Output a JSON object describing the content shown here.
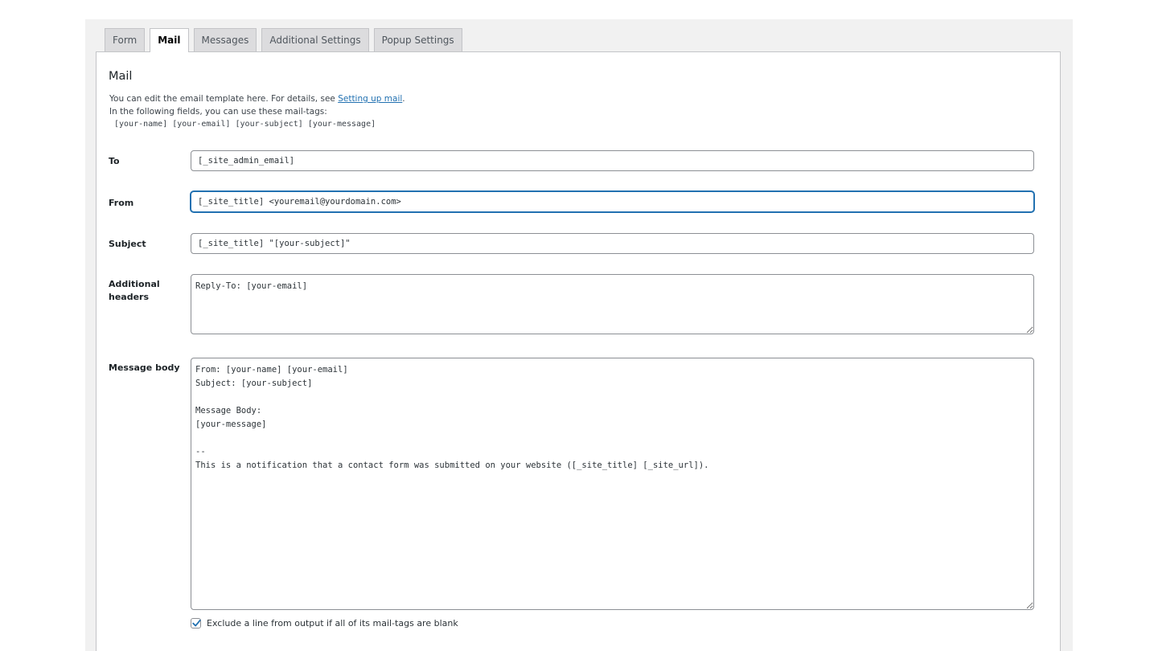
{
  "tabs": [
    {
      "label": "Form",
      "active": false
    },
    {
      "label": "Mail",
      "active": true
    },
    {
      "label": "Messages",
      "active": false
    },
    {
      "label": "Additional Settings",
      "active": false
    },
    {
      "label": "Popup Settings",
      "active": false
    }
  ],
  "mail": {
    "title": "Mail",
    "description_prefix": "You can edit the email template here. For details, see ",
    "description_link": "Setting up mail",
    "description_suffix": ".",
    "description_line2": "In the following fields, you can use these mail-tags:",
    "mail_tags": "[your-name] [your-email] [your-subject] [your-message]"
  },
  "fields": {
    "to": {
      "label": "To",
      "value": "[_site_admin_email]"
    },
    "from": {
      "label": "From",
      "value": "[_site_title] <youremail@yourdomain.com>"
    },
    "subject": {
      "label": "Subject",
      "value": "[_site_title] \"[your-subject]\""
    },
    "additional_headers": {
      "label_line1": "Additional",
      "label_line2": "headers",
      "value": "Reply-To: [your-email]"
    },
    "message_body": {
      "label": "Message body",
      "value": "From: [your-name] [your-email]\nSubject: [your-subject]\n\nMessage Body:\n[your-message]\n\n--\nThis is a notification that a contact form was submitted on your website ([_site_title] [_site_url])."
    }
  },
  "exclude_blank": {
    "label": "Exclude a line from output if all of its mail-tags are blank",
    "checked": true
  },
  "colors": {
    "accent": "#2271b1",
    "checkbox_accent": "#2271b1"
  }
}
